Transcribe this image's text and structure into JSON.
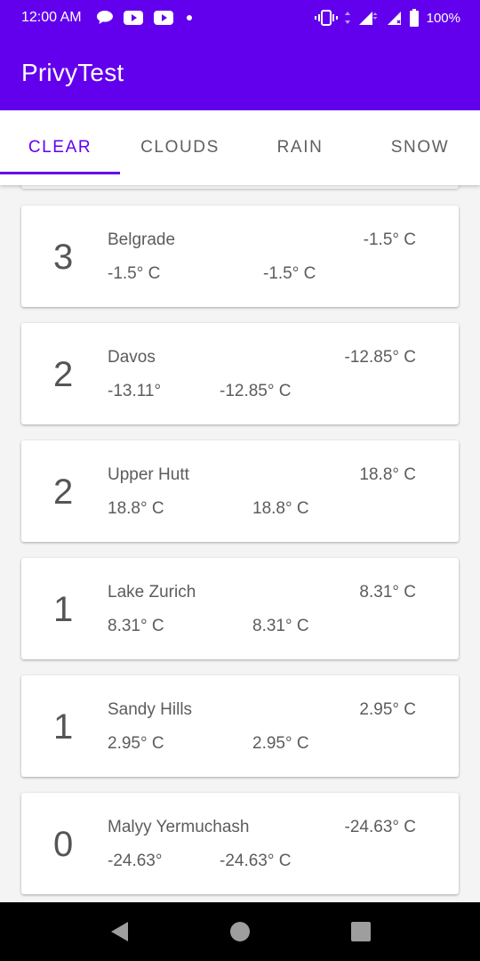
{
  "status_bar": {
    "time": "12:00 AM",
    "battery": "100%",
    "icons": [
      "chat-bubble-icon",
      "youtube-icon",
      "youtube-icon",
      "dot-icon",
      "vibrate-icon",
      "data-arrows-icon",
      "signal-icon",
      "signal-no-data-icon",
      "battery-icon"
    ]
  },
  "app_bar": {
    "title": "PrivyTest"
  },
  "tabs": [
    {
      "label": "CLEAR",
      "active": true
    },
    {
      "label": "CLOUDS",
      "active": false
    },
    {
      "label": "RAIN",
      "active": false
    },
    {
      "label": "SNOW",
      "active": false
    }
  ],
  "cards": [
    {
      "rank": "3",
      "city": "Belgrade",
      "temp": "-1.5° C",
      "temp_min": "-1.5° C",
      "temp_max": "-1.5° C"
    },
    {
      "rank": "2",
      "city": "Davos",
      "temp": "-12.85° C",
      "temp_min": "-13.11°",
      "temp_max": "-12.85° C"
    },
    {
      "rank": "2",
      "city": "Upper Hutt",
      "temp": "18.8° C",
      "temp_min": "18.8° C",
      "temp_max": "18.8° C"
    },
    {
      "rank": "1",
      "city": "Lake Zurich",
      "temp": "8.31° C",
      "temp_min": "8.31° C",
      "temp_max": "8.31° C"
    },
    {
      "rank": "1",
      "city": "Sandy Hills",
      "temp": "2.95° C",
      "temp_min": "2.95° C",
      "temp_max": "2.95° C"
    },
    {
      "rank": "0",
      "city": "Malyy Yermuchash",
      "temp": "-24.63° C",
      "temp_min": "-24.63°",
      "temp_max": "-24.63° C"
    }
  ],
  "colors": {
    "primary": "#6200ee",
    "text": "#5c5c5c"
  },
  "nav_bar": {
    "icons": [
      "back-icon",
      "home-icon",
      "recents-icon"
    ]
  }
}
